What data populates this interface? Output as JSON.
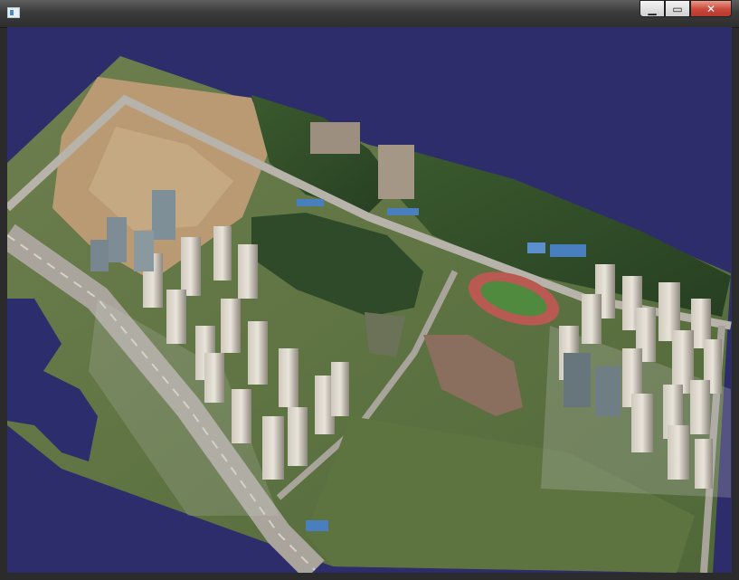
{
  "window": {
    "title": "",
    "controls": {
      "minimize": "▁",
      "maximize": "▭",
      "close": "✕"
    }
  },
  "viewport": {
    "background": "#2e2d6b",
    "content": "3d-city-model"
  },
  "icons": [
    "app-icon",
    "minimize-icon",
    "maximize-icon",
    "close-icon"
  ]
}
